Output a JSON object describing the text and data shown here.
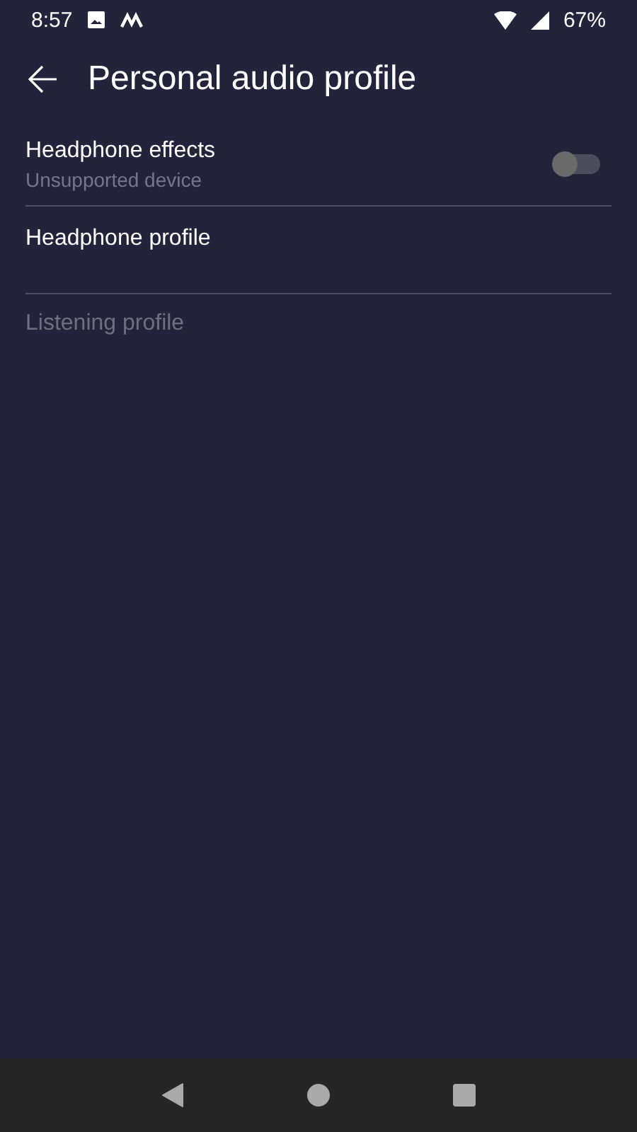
{
  "status_bar": {
    "time": "8:57",
    "battery": "67%"
  },
  "toolbar": {
    "title": "Personal audio profile"
  },
  "items": [
    {
      "kind": "switch",
      "title": "Headphone effects",
      "summary": "Unsupported device",
      "on": false,
      "disabled": true
    },
    {
      "kind": "plain",
      "title": "Headphone profile",
      "disabled": false
    },
    {
      "kind": "plain",
      "title": "Listening profile",
      "disabled": true
    }
  ]
}
